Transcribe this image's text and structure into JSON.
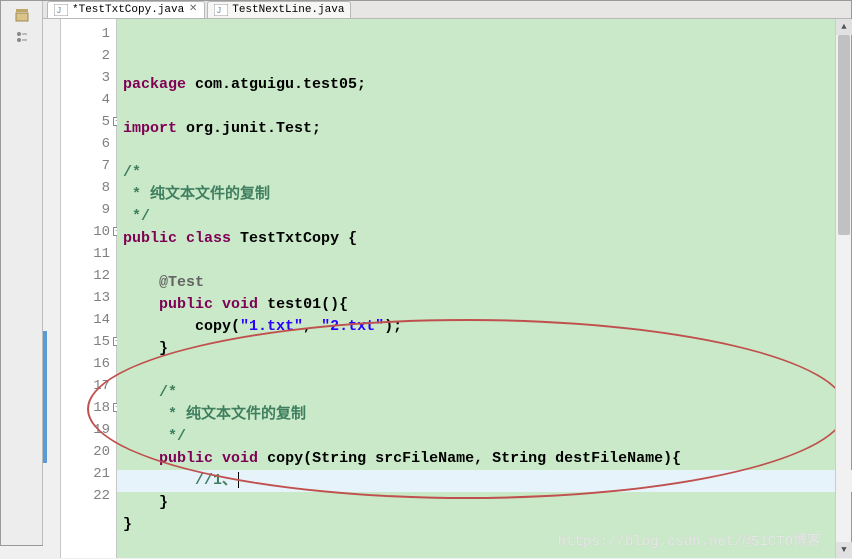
{
  "tabs": [
    {
      "label": "*TestTxtCopy.java",
      "active": true,
      "closable": true
    },
    {
      "label": "TestNextLine.java",
      "active": false,
      "closable": false
    }
  ],
  "code": {
    "lines": [
      {
        "n": "1",
        "html": "<span class='kw'>package</span> com.atguigu.test05;"
      },
      {
        "n": "2",
        "html": ""
      },
      {
        "n": "3",
        "html": "<span class='kw'>import</span> org.junit.Test;"
      },
      {
        "n": "4",
        "html": ""
      },
      {
        "n": "5",
        "fold": "-",
        "html": "<span class='cmt'>/*</span>"
      },
      {
        "n": "6",
        "html": "<span class='cmt'> * 纯文本文件的复制</span>"
      },
      {
        "n": "7",
        "html": "<span class='cmt'> */</span>"
      },
      {
        "n": "8",
        "html": "<span class='kw'>public</span> <span class='kw'>class</span> TestTxtCopy {"
      },
      {
        "n": "9",
        "html": ""
      },
      {
        "n": "10",
        "fold": "-",
        "html": "    <span class='ann'>@Test</span>"
      },
      {
        "n": "11",
        "html": "    <span class='kw'>public</span> <span class='kw'>void</span> test01(){"
      },
      {
        "n": "12",
        "html": "        copy(<span class='str'>\"1.txt\"</span>, <span class='str'>\"2.txt\"</span>);"
      },
      {
        "n": "13",
        "html": "    }"
      },
      {
        "n": "14",
        "html": ""
      },
      {
        "n": "15",
        "fold": "-",
        "change": true,
        "html": "    <span class='cmt'>/*</span>"
      },
      {
        "n": "16",
        "change": true,
        "html": "    <span class='cmt'> * 纯文本文件的复制</span>"
      },
      {
        "n": "17",
        "change": true,
        "html": "    <span class='cmt'> */</span>"
      },
      {
        "n": "18",
        "fold": "-",
        "change": true,
        "html": "    <span class='kw'>public</span> <span class='kw'>void</span> copy(String srcFileName, String destFileName){"
      },
      {
        "n": "19",
        "change": true,
        "current": true,
        "html": "        <span class='cmt'>//1、</span><span class='cursor'></span>"
      },
      {
        "n": "20",
        "change": true,
        "html": "    }"
      },
      {
        "n": "21",
        "html": "}"
      },
      {
        "n": "22",
        "html": ""
      }
    ]
  },
  "watermark": "https://blog.csdn.net/@51CTO博客"
}
